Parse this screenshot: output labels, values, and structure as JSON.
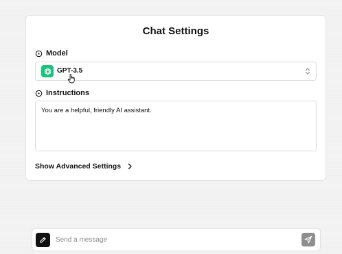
{
  "settings": {
    "title": "Chat Settings",
    "model": {
      "label": "Model",
      "icon": "info-circle-icon",
      "selected": "GPT-3.5",
      "logo_icon": "openai-logo-icon",
      "logo_color": "#19c37d"
    },
    "instructions": {
      "label": "Instructions",
      "icon": "info-circle-icon",
      "value": "You are a helpful, friendly AI assistant."
    },
    "advanced": {
      "label": "Show Advanced Settings",
      "icon": "chevron-right-icon"
    }
  },
  "composer": {
    "placeholder": "Send a message",
    "edit_icon": "pencil-icon",
    "send_icon": "send-icon",
    "edit_color": "#111111",
    "send_color": "#8e8e8e"
  }
}
